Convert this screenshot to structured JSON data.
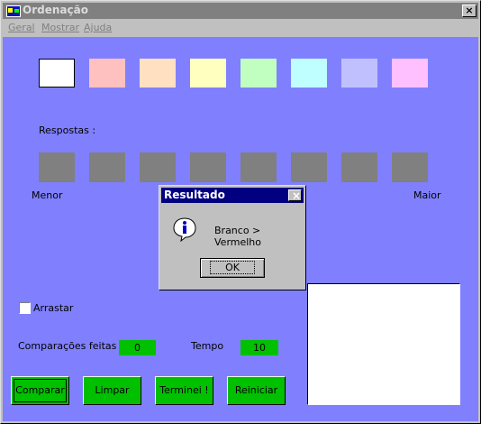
{
  "window": {
    "title": "Ordenação",
    "close_label": "×"
  },
  "menu": {
    "items": [
      "Geral",
      "Mostrar",
      "Ajuda"
    ]
  },
  "swatches": {
    "colors": [
      "#ffffff",
      "#ffc0c0",
      "#ffe0c0",
      "#ffffc0",
      "#c0ffc0",
      "#c0ffff",
      "#c0c0ff",
      "#ffc0ff"
    ],
    "selected_index": 0
  },
  "answers": {
    "label": "Respostas :",
    "slot_color": "#808080",
    "min_label": "Menor",
    "max_label": "Maior"
  },
  "options": {
    "drag_label": "Arrastar",
    "drag_checked": false
  },
  "stats": {
    "comparisons_label": "Comparações feitas",
    "comparisons_value": "0",
    "time_label": "Tempo",
    "time_value": "10"
  },
  "buttons": {
    "compare": "Comparar",
    "clear": "Limpar",
    "done": "Terminei !",
    "restart": "Reiniciar"
  },
  "dialog": {
    "title": "Resultado",
    "close_label": "×",
    "message": "Branco > Vermelho",
    "ok_label": "OK"
  },
  "colors": {
    "client_bg": "#8080ff",
    "button_green": "#00c000",
    "dialog_title_bg": "#000080"
  }
}
